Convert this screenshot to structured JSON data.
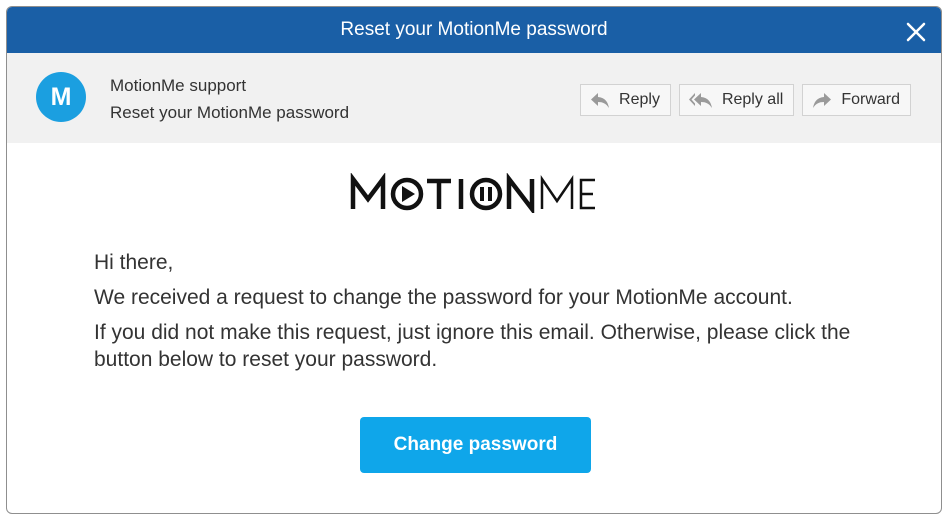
{
  "window": {
    "title": "Reset your MotionMe password"
  },
  "header": {
    "avatar_letter": "M",
    "sender": "MotionMe support",
    "subject": "Reset your MotionMe password",
    "actions": {
      "reply": "Reply",
      "reply_all": "Reply all",
      "forward": "Forward"
    }
  },
  "logo": {
    "text": "MOTIONME"
  },
  "body": {
    "greeting": "Hi there,",
    "paragraph1": "We received a request to change the password for your MotionMe account.",
    "paragraph2": "If you did not make this request, just ignore this email. Otherwise, please click the button below to reset your password."
  },
  "cta": {
    "label": "Change password"
  },
  "colors": {
    "titlebar": "#1a5fa6",
    "avatar": "#1b9fe0",
    "button": "#0fa6ea"
  },
  "icons": [
    "close-icon",
    "reply-icon",
    "reply-all-icon",
    "forward-icon",
    "play-icon",
    "pause-icon"
  ]
}
